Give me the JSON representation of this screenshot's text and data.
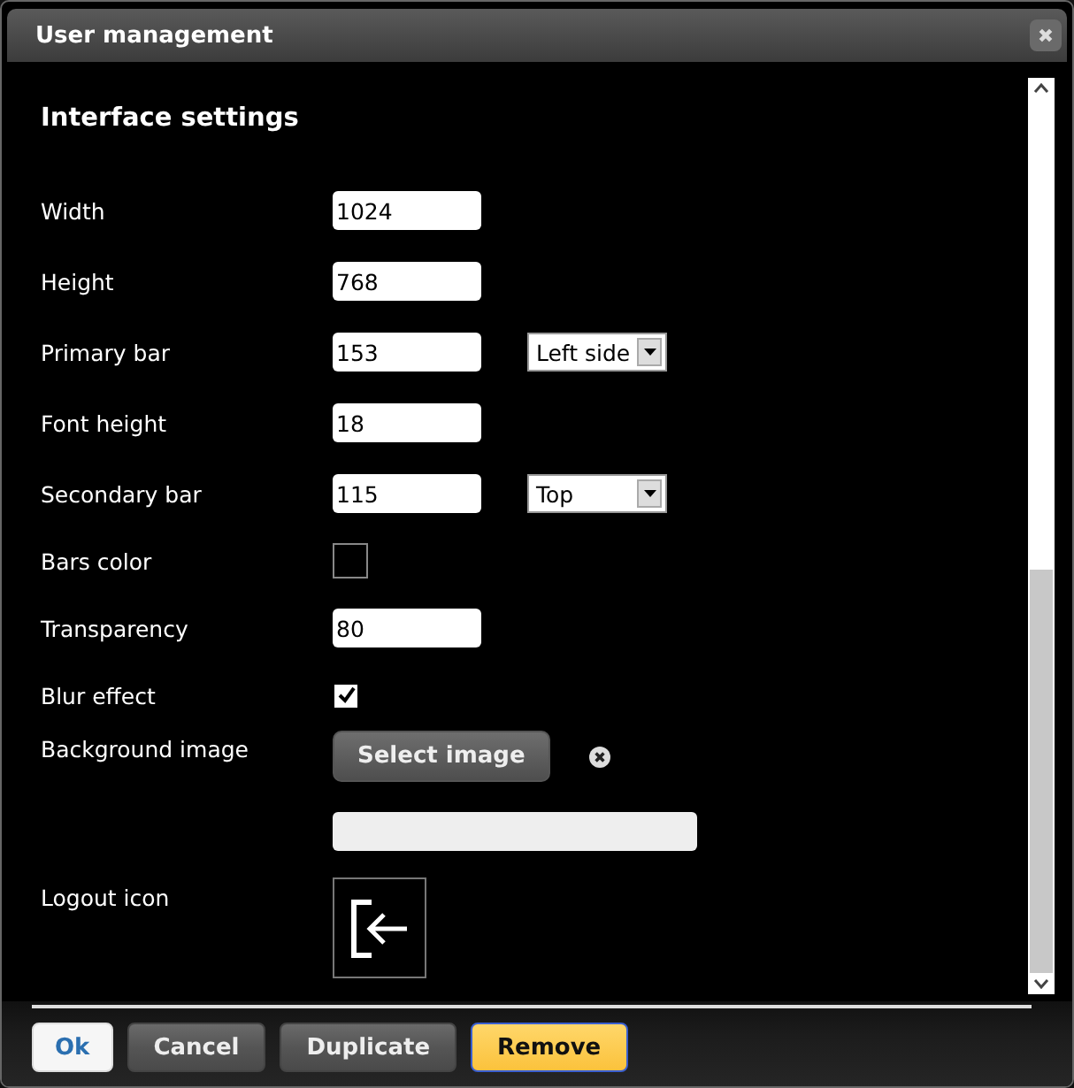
{
  "window": {
    "title": "User management",
    "close_icon": "✖"
  },
  "section": {
    "title": "Interface settings"
  },
  "rows": [
    {
      "kind": "text",
      "label": "Width",
      "value": "1024"
    },
    {
      "kind": "text",
      "label": "Height",
      "value": "768"
    },
    {
      "kind": "text",
      "label": "Primary bar",
      "value": "153",
      "select": "Left side"
    },
    {
      "kind": "text",
      "label": "Font height",
      "value": "18"
    },
    {
      "kind": "text",
      "label": "Secondary bar",
      "value": "115",
      "select": "Top"
    },
    {
      "kind": "color",
      "label": "Bars color",
      "color": "#000000"
    },
    {
      "kind": "text",
      "label": "Transparency",
      "value": "80"
    },
    {
      "kind": "checkbox",
      "label": "Blur effect",
      "checked": true
    },
    {
      "kind": "image",
      "label": "Background image",
      "button": "Select image"
    },
    {
      "kind": "icon",
      "label": "Logout icon"
    }
  ],
  "buttons": [
    {
      "label": "Ok",
      "kind": "primary"
    },
    {
      "label": "Cancel",
      "kind": "secondary"
    },
    {
      "label": "Duplicate",
      "kind": "secondary"
    },
    {
      "label": "Remove",
      "kind": "warning"
    }
  ]
}
